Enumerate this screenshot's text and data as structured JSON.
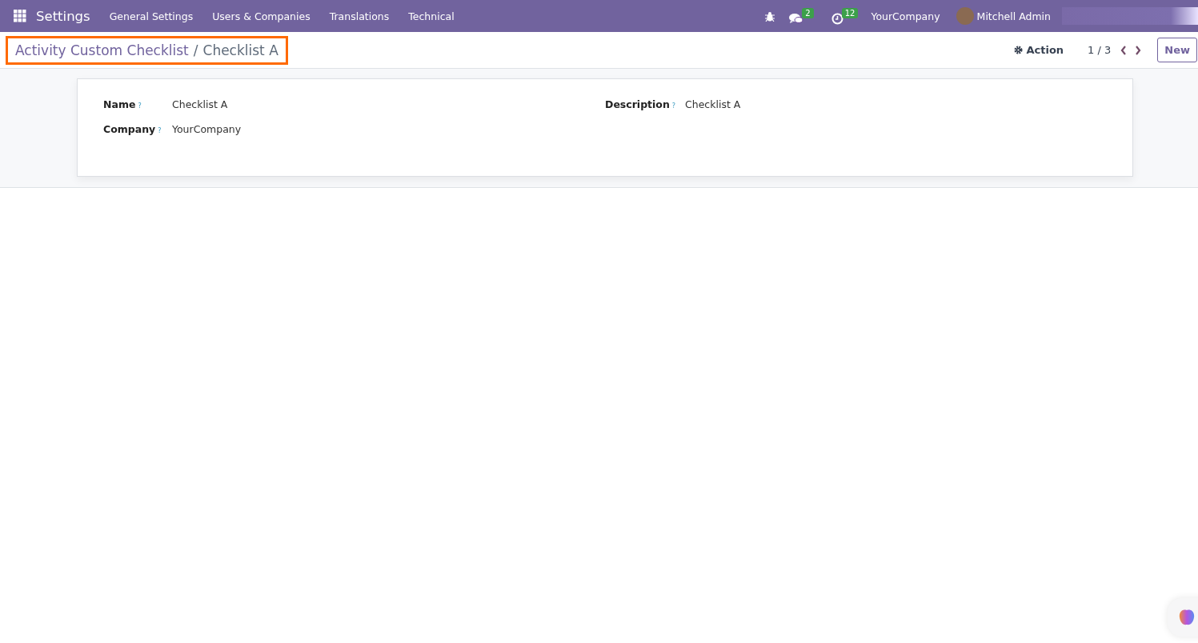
{
  "navbar": {
    "app_title": "Settings",
    "menu": [
      "General Settings",
      "Users & Companies",
      "Translations",
      "Technical"
    ],
    "messages_count": "2",
    "activities_count": "12",
    "company": "YourCompany",
    "user": "Mitchell Admin"
  },
  "control_panel": {
    "breadcrumb": {
      "parent": "Activity Custom Checklist",
      "separator": "/",
      "current": "Checklist A"
    },
    "highlighted": true,
    "action": "Action",
    "pager": "1 / 3",
    "new_button": "New"
  },
  "form": {
    "left": [
      {
        "label": "Name",
        "help": "?",
        "value": "Checklist A"
      },
      {
        "label": "Company",
        "help": "?",
        "value": "YourCompany"
      }
    ],
    "right": [
      {
        "label": "Description",
        "help": "?",
        "value": "Checklist A"
      }
    ]
  }
}
